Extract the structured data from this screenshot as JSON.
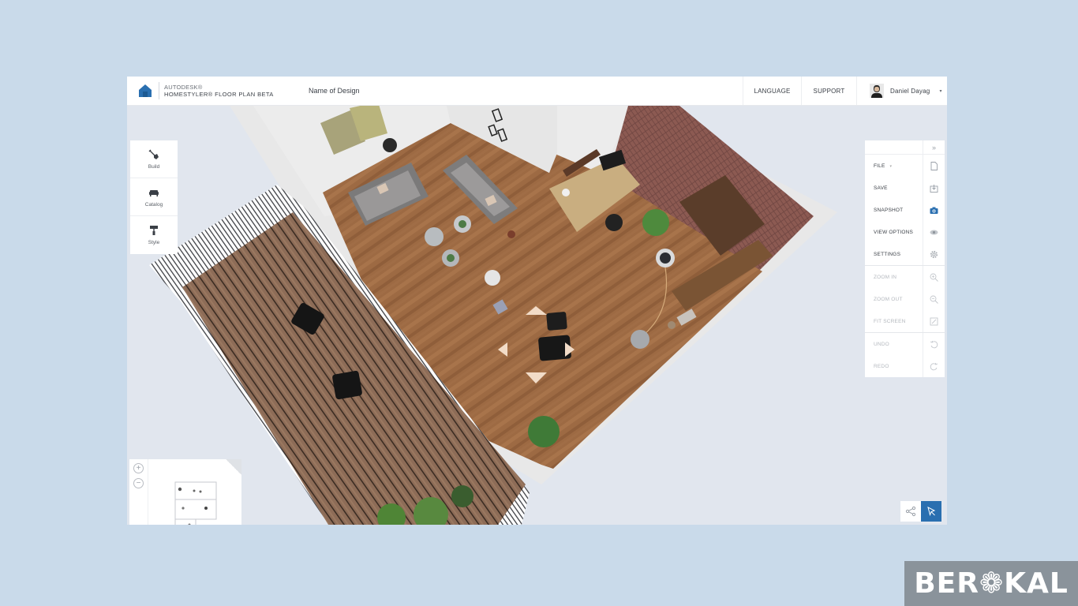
{
  "app": {
    "brand_line": "AUTODESK®",
    "product_line": "HOMESTYLER® FLOOR PLAN  BETA",
    "design_name": "Name of Design"
  },
  "header": {
    "language_label": "LANGUAGE",
    "support_label": "SUPPORT",
    "user_name": "Daniel Dayag",
    "user_caret": "▾"
  },
  "left_tools": [
    {
      "label": "Build",
      "icon": "shovel-icon"
    },
    {
      "label": "Catalog",
      "icon": "sofa-icon"
    },
    {
      "label": "Style",
      "icon": "paint-roller-icon"
    }
  ],
  "right_panel": {
    "collapse_icon": "»",
    "items": [
      {
        "label": "FILE",
        "icon": "file-icon",
        "caret": "▾",
        "enabled": true
      },
      {
        "label": "SAVE",
        "icon": "save-icon",
        "enabled": true
      },
      {
        "label": "SNAPSHOT",
        "icon": "camera-icon",
        "enabled": true
      },
      {
        "label": "VIEW OPTIONS",
        "icon": "eye-icon",
        "enabled": true
      },
      {
        "label": "SETTINGS",
        "icon": "gear-icon",
        "enabled": true
      },
      {
        "label": "ZOOM IN",
        "icon": "zoom-in-icon",
        "enabled": false
      },
      {
        "label": "ZOOM OUT",
        "icon": "zoom-out-icon",
        "enabled": false
      },
      {
        "label": "FIT SCREEN",
        "icon": "fit-screen-icon",
        "enabled": false
      },
      {
        "label": "UNDO",
        "icon": "undo-icon",
        "enabled": false
      },
      {
        "label": "REDO",
        "icon": "redo-icon",
        "enabled": false
      }
    ]
  },
  "minimap": {
    "zoom_in": "+",
    "zoom_out": "−"
  },
  "colors": {
    "accent": "#2a6fb0",
    "page_bg": "#c9daea",
    "canvas_bg": "#e1e6ee",
    "floor_wood": "#9c6b45",
    "deck_wood": "#8a6a55",
    "brick": "#8f5a52",
    "wall": "#e9e9e9"
  },
  "watermark": {
    "text": "BER❁KAL"
  }
}
